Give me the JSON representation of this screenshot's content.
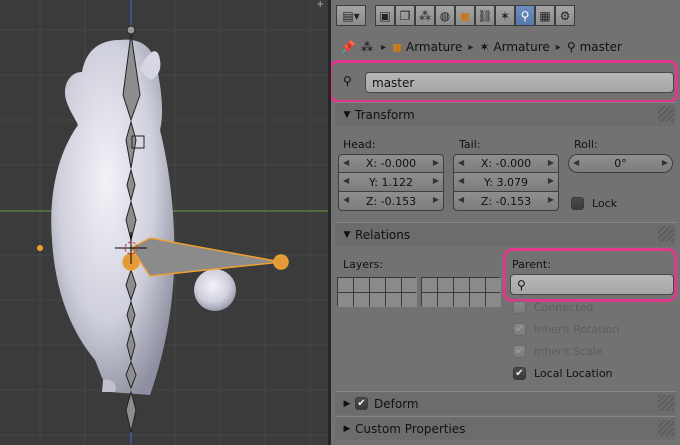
{
  "properties": {
    "context_tabs": [
      {
        "name": "render-icon",
        "active": false
      },
      {
        "name": "render-layers-icon",
        "active": false
      },
      {
        "name": "scene-icon",
        "active": false
      },
      {
        "name": "world-icon",
        "active": false
      },
      {
        "name": "object-icon",
        "active": false
      },
      {
        "name": "constraints-icon",
        "active": false
      },
      {
        "name": "armature-data-icon",
        "active": false
      },
      {
        "name": "bone-icon",
        "active": true
      },
      {
        "name": "texture-icon",
        "active": false
      },
      {
        "name": "bone-constraints-icon",
        "active": false
      }
    ],
    "breadcrumb": {
      "object": "Armature",
      "armature": "Armature",
      "bone": "master"
    },
    "bone_name": "master",
    "transform": {
      "title": "Transform",
      "head_label": "Head:",
      "tail_label": "Tail:",
      "roll_label": "Roll:",
      "head": {
        "x": "X: -0.000",
        "y": "Y: 1.122",
        "z": "Z: -0.153"
      },
      "tail": {
        "x": "X: -0.000",
        "y": "Y: 3.079",
        "z": "Z: -0.153"
      },
      "roll": "0°",
      "lock_label": "Lock",
      "lock_checked": false
    },
    "relations": {
      "title": "Relations",
      "layers_label": "Layers:",
      "parent_label": "Parent:",
      "parent_value": "",
      "connected": {
        "label": "Connected",
        "checked": false,
        "enabled": false
      },
      "inherit_rotation": {
        "label": "Inherit Rotation",
        "checked": true,
        "enabled": false
      },
      "inherit_scale": {
        "label": "Inherit Scale",
        "checked": true,
        "enabled": false
      },
      "local_location": {
        "label": "Local Location",
        "checked": true,
        "enabled": true
      }
    },
    "deform": {
      "title": "Deform",
      "checked": true
    },
    "custom_properties": {
      "title": "Custom Properties"
    }
  },
  "colors": {
    "highlight": "#e0388a",
    "selected_bone": "#f0a030",
    "active_tab": "#5578ab",
    "viewport_bg": "#3b3b3b",
    "panel_bg": "#727272"
  }
}
